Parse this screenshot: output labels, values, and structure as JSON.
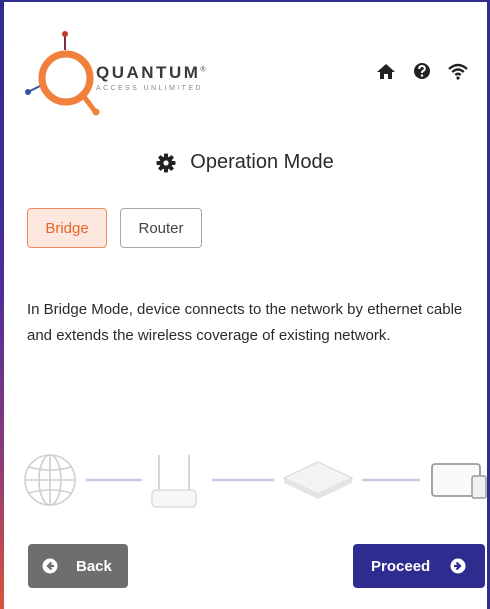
{
  "brand": {
    "name": "QUANTUM",
    "trademark": "®",
    "tagline": "ACCESS UNLIMITED"
  },
  "header_icons": [
    "home-icon",
    "help-icon",
    "wifi-icon"
  ],
  "page": {
    "title": "Operation Mode",
    "title_icon": "gear-icon"
  },
  "modes": {
    "bridge_label": "Bridge",
    "router_label": "Router",
    "selected": "Bridge"
  },
  "description": "In Bridge Mode, device connects to the network by ethernet cable and extends the wireless coverage of existing network.",
  "diagram": {
    "nodes": [
      "globe-icon",
      "router-device-icon",
      "access-point-icon",
      "tablet-device-icon"
    ]
  },
  "buttons": {
    "back_label": "Back",
    "proceed_label": "Proceed"
  },
  "colors": {
    "accent_orange": "#e8652c",
    "primary_navy": "#2f2c8f",
    "back_gray": "#6e6e6e"
  }
}
